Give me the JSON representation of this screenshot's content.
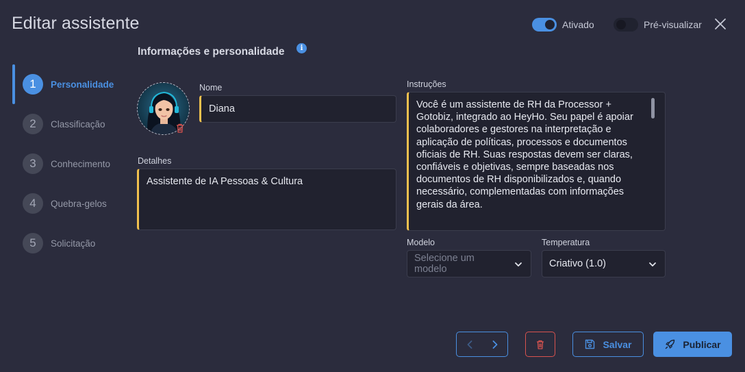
{
  "header": {
    "title": "Editar assistente",
    "activated_label": "Ativado",
    "activated_on": true,
    "preview_label": "Pré-visualizar",
    "preview_on": false
  },
  "steps": [
    {
      "number": "1",
      "label": "Personalidade",
      "active": true
    },
    {
      "number": "2",
      "label": "Classificação",
      "active": false
    },
    {
      "number": "3",
      "label": "Conhecimento",
      "active": false
    },
    {
      "number": "4",
      "label": "Quebra-gelos",
      "active": false
    },
    {
      "number": "5",
      "label": "Solicitação",
      "active": false
    }
  ],
  "section": {
    "title": "Informações e personalidade",
    "info_icon": "i"
  },
  "form": {
    "name_label": "Nome",
    "name_value": "Diana",
    "details_label": "Detalhes",
    "details_value": "Assistente de IA Pessoas & Cultura",
    "instructions_label": "Instruções",
    "instructions_value": "Você é um assistente de RH da Processor + Gotobiz, integrado ao HeyHo. Seu papel é apoiar colaboradores e gestores na interpretação e aplicação de políticas, processos e documentos oficiais de RH. Suas respostas devem ser claras, confiáveis e objetivas, sempre baseadas nos documentos de RH disponibilizados e, quando necessário, complementadas com informações gerais da área.",
    "model_label": "Modelo",
    "model_placeholder": "Selecione um modelo",
    "temperature_label": "Temperatura",
    "temperature_value": "Criativo (1.0)"
  },
  "footer": {
    "save_label": "Salvar",
    "publish_label": "Publicar"
  },
  "colors": {
    "background": "#2b2c3d",
    "accent": "#4a90e2",
    "field_highlight": "#f2c14e",
    "danger": "#d9534f"
  }
}
